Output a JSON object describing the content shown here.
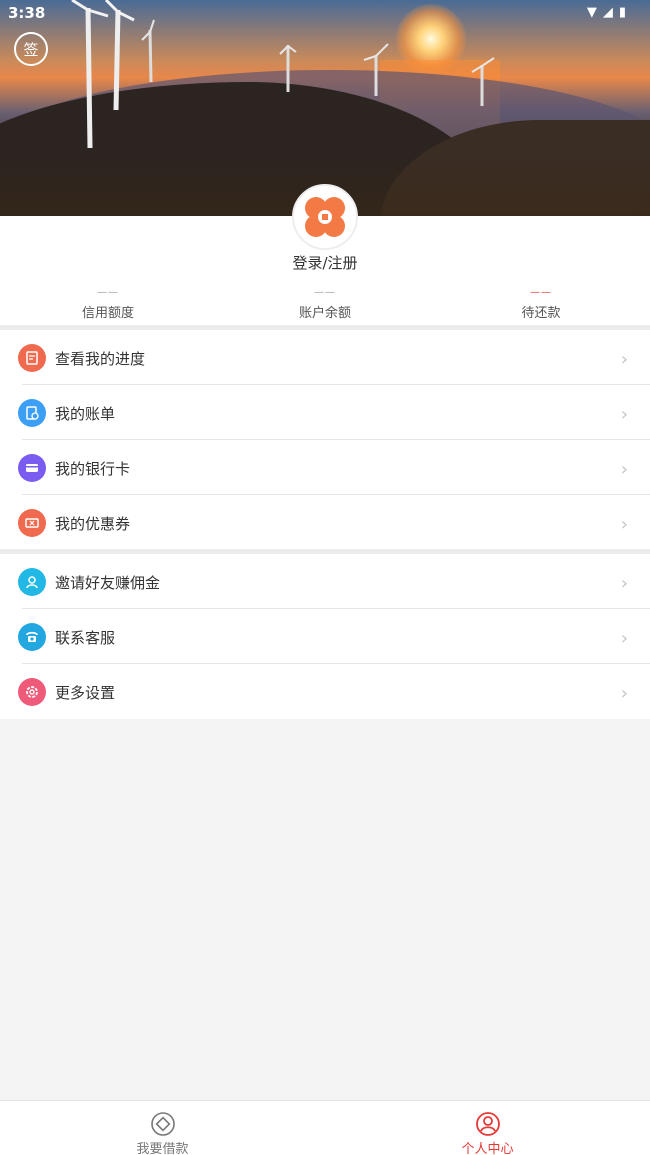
{
  "status_bar": {
    "time": "3:38"
  },
  "header": {
    "sign_label": "签"
  },
  "profile": {
    "login_label": "登录/注册"
  },
  "stats": [
    {
      "value": "——",
      "label": "信用额度",
      "highlight": false
    },
    {
      "value": "——",
      "label": "账户余额",
      "highlight": false
    },
    {
      "value": "——",
      "label": "待还款",
      "highlight": true
    }
  ],
  "menu_group_1": [
    {
      "label": "查看我的进度",
      "icon": "progress-icon",
      "color": "#f06a4f"
    },
    {
      "label": "我的账单",
      "icon": "bill-icon",
      "color": "#3b9ff5"
    },
    {
      "label": "我的银行卡",
      "icon": "bank-card-icon",
      "color": "#7a5cf0"
    },
    {
      "label": "我的优惠券",
      "icon": "coupon-icon",
      "color": "#f06a4f"
    }
  ],
  "menu_group_2": [
    {
      "label": "邀请好友赚佣金",
      "icon": "invite-friend-icon",
      "color": "#22b8e6"
    },
    {
      "label": "联系客服",
      "icon": "phone-icon",
      "color": "#22a7e0"
    },
    {
      "label": "更多设置",
      "icon": "settings-icon",
      "color": "#f05a7a"
    }
  ],
  "bottom_nav": {
    "tabs": [
      {
        "label": "我要借款",
        "icon": "loan-icon",
        "active": false
      },
      {
        "label": "个人中心",
        "icon": "user-center-icon",
        "active": true
      }
    ]
  },
  "colors": {
    "accent": "#e53935",
    "inactive": "#777777"
  }
}
